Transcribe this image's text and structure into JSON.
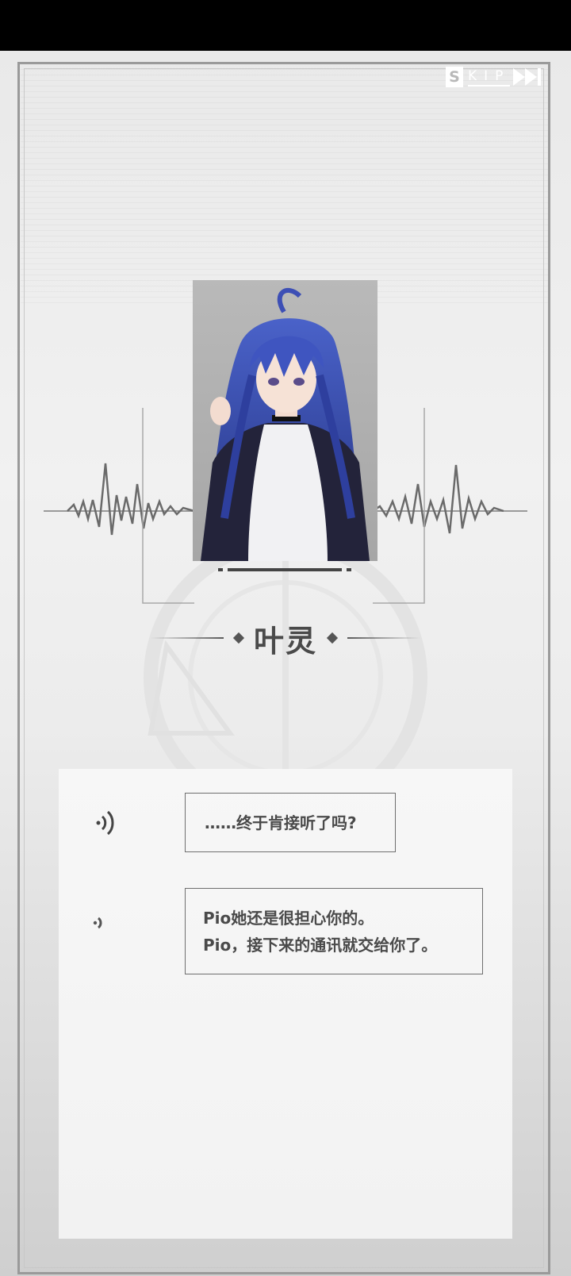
{
  "header": {
    "skip_label_first": "S",
    "skip_label_rest": "KIP",
    "skip_icon": "fast-forward-icon"
  },
  "character": {
    "name": "叶灵",
    "portrait": "anime-girl-blue-hair-portrait"
  },
  "dialog": {
    "messages": [
      {
        "icon": "sound-wave-icon",
        "line1": "……终于肯接听了吗?"
      },
      {
        "icon": "sound-wave-small-icon",
        "line1": "Pio她还是很担心你的。",
        "line2": "Pio，接下来的通讯就交给你了。"
      }
    ]
  },
  "colors": {
    "frame": "#9a9a9a",
    "text": "#4a4a4a",
    "hair": "#3d4fb5",
    "panel": "#f4f4f4"
  }
}
